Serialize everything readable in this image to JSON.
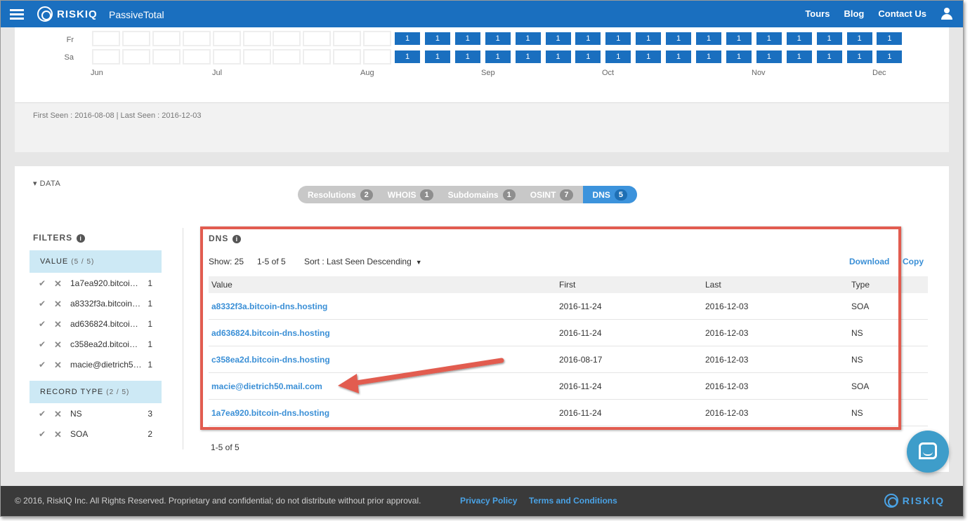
{
  "topnav": {
    "brand": "RISKIQ",
    "product": "PassiveTotal",
    "links": [
      "Tours",
      "Blog",
      "Contact Us"
    ]
  },
  "calendar": {
    "days": [
      "Fr",
      "Sa"
    ],
    "months": [
      "Jun",
      "Jul",
      "Aug",
      "Sep",
      "Oct",
      "Nov",
      "Dec"
    ],
    "active_value": "1",
    "total_weeks": 27,
    "first_active_week": 10,
    "first_seen_text": "First Seen : 2016-08-08 | Last Seen : 2016-12-03"
  },
  "data_section": {
    "toggle_label": "DATA",
    "tabs": [
      {
        "label": "Resolutions",
        "count": "2",
        "active": false
      },
      {
        "label": "WHOIS",
        "count": "1",
        "active": false
      },
      {
        "label": "Subdomains",
        "count": "1",
        "active": false
      },
      {
        "label": "OSINT",
        "count": "7",
        "active": false
      },
      {
        "label": "DNS",
        "count": "5",
        "active": true
      }
    ]
  },
  "filters": {
    "title": "FILTERS",
    "groups": [
      {
        "title": "VALUE",
        "count": "(5 / 5)",
        "items": [
          {
            "value": "1a7ea920.bitcoin-dns.hosting",
            "count": "1"
          },
          {
            "value": "a8332f3a.bitcoin-dns.hosting",
            "count": "1"
          },
          {
            "value": "ad636824.bitcoin-dns.hosting",
            "count": "1"
          },
          {
            "value": "c358ea2d.bitcoin-dns.hosting",
            "count": "1"
          },
          {
            "value": "macie@dietrich50.mail.com",
            "count": "1"
          }
        ]
      },
      {
        "title": "RECORD TYPE",
        "count": "(2 / 5)",
        "items": [
          {
            "value": "NS",
            "count": "3"
          },
          {
            "value": "SOA",
            "count": "2"
          }
        ]
      }
    ]
  },
  "dns": {
    "title": "DNS",
    "show": "Show: 25",
    "range": "1-5 of 5",
    "sort": "Sort : Last Seen Descending",
    "download": "Download",
    "copy": "Copy",
    "columns": [
      "Value",
      "First",
      "Last",
      "Type"
    ],
    "rows": [
      {
        "value": "a8332f3a.bitcoin-dns.hosting",
        "first": "2016-11-24",
        "last": "2016-12-03",
        "type": "SOA"
      },
      {
        "value": "ad636824.bitcoin-dns.hosting",
        "first": "2016-11-24",
        "last": "2016-12-03",
        "type": "NS"
      },
      {
        "value": "c358ea2d.bitcoin-dns.hosting",
        "first": "2016-08-17",
        "last": "2016-12-03",
        "type": "NS"
      },
      {
        "value": "macie@dietrich50.mail.com",
        "first": "2016-11-24",
        "last": "2016-12-03",
        "type": "SOA"
      },
      {
        "value": "1a7ea920.bitcoin-dns.hosting",
        "first": "2016-11-24",
        "last": "2016-12-03",
        "type": "NS"
      }
    ],
    "pager": "1-5 of 5"
  },
  "footer": {
    "copyright": "© 2016, RiskIQ Inc. All Rights Reserved. Proprietary and confidential; do not distribute without prior approval.",
    "privacy": "Privacy Policy",
    "terms": "Terms and Conditions",
    "logo": "RISKIQ"
  },
  "colors": {
    "brand_blue": "#1a6fbf",
    "link_blue": "#3a8fd6",
    "annotation_red": "#e25c50",
    "filter_head_bg": "#cde9f5"
  }
}
